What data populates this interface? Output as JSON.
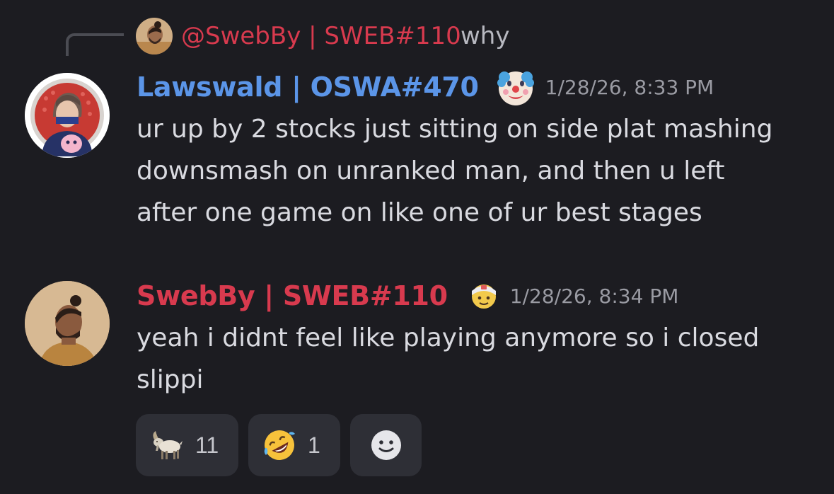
{
  "reply": {
    "mention": "@SwebBy | SWEB#110",
    "text": "why"
  },
  "messages": [
    {
      "username": "Lawswald | OSWA#470",
      "username_color": "#5b95e8",
      "badge_icon": "clown-face-icon",
      "timestamp": "1/28/26, 8:33 PM",
      "lines": [
        "ur up by 2 stocks just sitting on side plat mashing",
        "downsmash on unranked man, and then u left",
        "after one game on like one of ur best stages"
      ]
    },
    {
      "username": "SwebBy | SWEB#110",
      "username_color": "#d83a4e",
      "badge_icon": "face-with-head-bandage-icon",
      "timestamp": "1/28/26, 8:34 PM",
      "lines": [
        "yeah i didnt feel like playing anymore so i closed",
        "slippi"
      ]
    }
  ],
  "reactions": [
    {
      "emoji": "goat-icon",
      "count": "11"
    },
    {
      "emoji": "rolling-on-floor-laughing-icon",
      "count": "1"
    },
    {
      "emoji": "add-reaction-icon",
      "count": ""
    }
  ],
  "colors": {
    "background": "#1c1c21",
    "reaction_bg": "#2e2f36",
    "mention": "#d83a4e",
    "timestamp": "#9a9ba3"
  }
}
